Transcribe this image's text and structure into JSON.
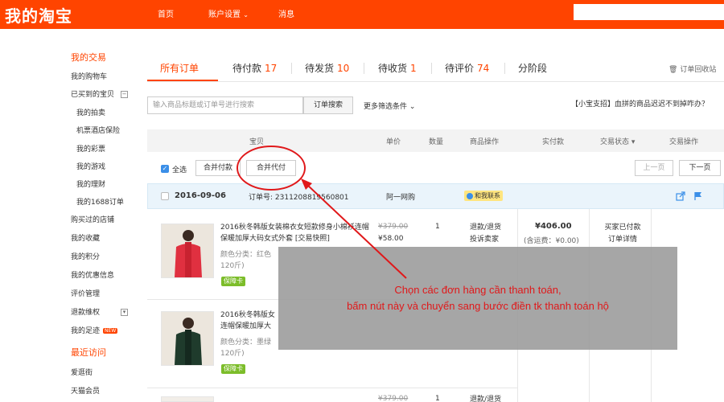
{
  "header": {
    "logo": "我的淘宝",
    "nav": [
      "首页",
      "账户设置",
      "消息"
    ],
    "search_placeholder": ""
  },
  "sidebar": {
    "section1_title": "我的交易",
    "items1": [
      "我的购物车",
      "已买到的宝贝",
      "我的拍卖",
      "机票酒店保险",
      "我的彩票",
      "我的游戏",
      "我的理财",
      "我的1688订单"
    ],
    "items2": [
      "购买过的店铺",
      "我的收藏",
      "我的积分",
      "我的优惠信息",
      "评价管理",
      "退款维权",
      "我的足迹"
    ],
    "new_badge": "NEW",
    "section2_title": "最近访问",
    "items3": [
      "爱逛街",
      "天猫会员"
    ]
  },
  "tabs": {
    "items": [
      {
        "label": "所有订单",
        "count": ""
      },
      {
        "label": "待付款",
        "count": "17"
      },
      {
        "label": "待发货",
        "count": "10"
      },
      {
        "label": "待收货",
        "count": "1"
      },
      {
        "label": "待评价",
        "count": "74"
      },
      {
        "label": "分阶段",
        "count": ""
      }
    ],
    "recycle": "订单回收站"
  },
  "search": {
    "placeholder": "输入商品标题或订单号进行搜索",
    "button": "订单搜索",
    "more_filters": "更多筛选条件",
    "notice": "【小宝支招】血拼的商品迟迟不到掉咋办？"
  },
  "table_header": {
    "columns": [
      "宝贝",
      "单价",
      "数量",
      "商品操作",
      "实付款",
      "交易状态",
      "交易操作"
    ]
  },
  "actions": {
    "select_all": "全选",
    "merge_pay": "合并付款",
    "merge_proxy_pay": "合并代付",
    "prev_page": "上一页",
    "next_page": "下一页"
  },
  "order": {
    "date": "2016-09-06",
    "order_no": "订单号: 2311208819560801",
    "shop": "阿一网购",
    "contact": "和我联系",
    "items": [
      {
        "title": "2016秋冬韩版女装棉衣女短款修身小棉袄连帽保暖加厚大码女式外套 [交易快照]",
        "attr1": "颜色分类：红色",
        "attr2": "120斤)",
        "guarantee": "保障卡",
        "price_old": "¥379.00",
        "price_new": "¥58.00",
        "qty": "1",
        "op1": "退款/退货",
        "op2": "投诉卖家",
        "paid": "¥406.00",
        "shipping": "(含运费：¥0.00)",
        "status1": "买家已付款",
        "status2": "订单详情"
      },
      {
        "title": "2016秋冬韩版女",
        "title2": "连帽保暖加厚大",
        "attr1": "颜色分类：墨绿",
        "attr2": "120斤)",
        "guarantee": "保障卡"
      },
      {
        "price_old": "¥379.00",
        "qty": "1",
        "op1": "退款/退货"
      }
    ]
  },
  "annotation": {
    "line1": "Chọn các đơn hàng cần thanh toán,",
    "line2": "bấm nút này và chuyển sang bước điền tk thanh toán hộ"
  },
  "colors": {
    "brand": "#ff4400",
    "annotation_red": "#e0181a",
    "overlay_gray": "#969696",
    "checkbox_blue": "#3b8fe8"
  }
}
